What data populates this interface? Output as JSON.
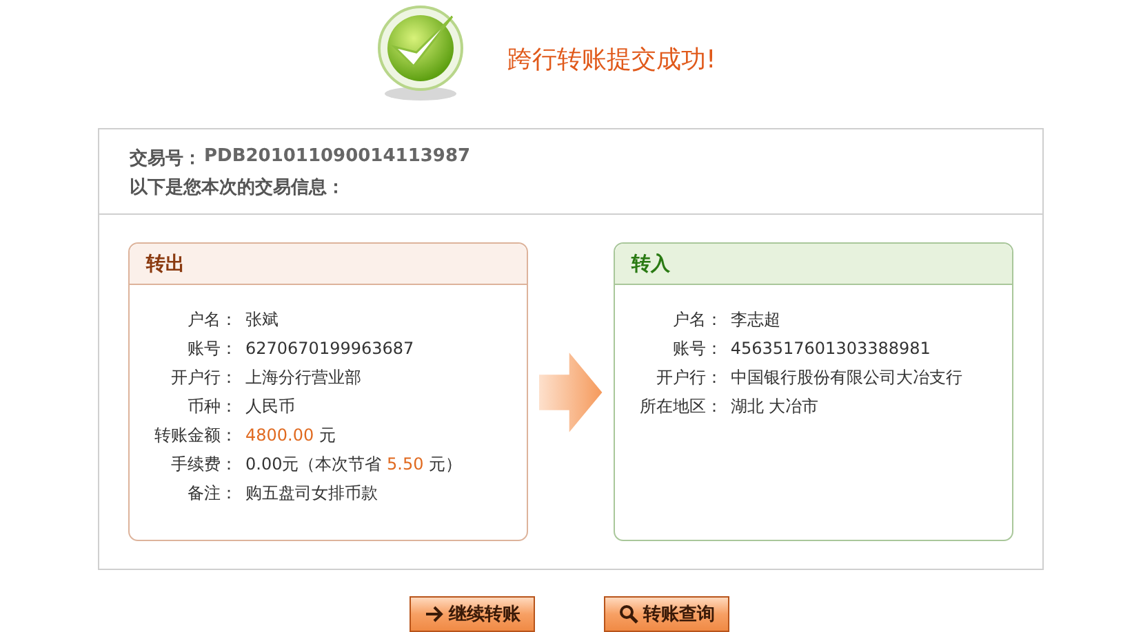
{
  "title": "跨行转账提交成功!",
  "transaction": {
    "label": "交易号：",
    "number": "PDB201011090014113987",
    "note": "以下是您本次的交易信息："
  },
  "panels": [
    {
      "kind": "out",
      "title": "转出",
      "rows": [
        {
          "label": "户名：",
          "segments": [
            {
              "text": "张斌",
              "highlight": false
            }
          ]
        },
        {
          "label": "账号：",
          "segments": [
            {
              "text": "6270670199963687",
              "highlight": false
            }
          ]
        },
        {
          "label": "开户行：",
          "segments": [
            {
              "text": "上海分行营业部",
              "highlight": false
            }
          ]
        },
        {
          "label": "币种：",
          "segments": [
            {
              "text": "人民币",
              "highlight": false
            }
          ]
        },
        {
          "label": "转账金额：",
          "segments": [
            {
              "text": "4800.00",
              "highlight": true
            },
            {
              "text": "元",
              "highlight": false
            }
          ]
        },
        {
          "label": "手续费：",
          "segments": [
            {
              "text": "0.00元（本次节省",
              "highlight": false
            },
            {
              "text": "5.50",
              "highlight": true
            },
            {
              "text": "元）",
              "highlight": false
            }
          ]
        },
        {
          "label": "备注：",
          "segments": [
            {
              "text": "购五盘司女排币款",
              "highlight": false
            }
          ]
        }
      ]
    },
    {
      "kind": "in",
      "title": "转入",
      "rows": [
        {
          "label": "户名：",
          "segments": [
            {
              "text": "李志超",
              "highlight": false
            }
          ]
        },
        {
          "label": "账号：",
          "segments": [
            {
              "text": "4563517601303388981",
              "highlight": false
            }
          ]
        },
        {
          "label": "开户行：",
          "segments": [
            {
              "text": "中国银行股份有限公司大冶支行",
              "highlight": false
            }
          ]
        },
        {
          "label": "所在地区：",
          "segments": [
            {
              "text": "湖北 大冶市",
              "highlight": false
            }
          ]
        }
      ]
    }
  ],
  "buttons": [
    {
      "kind": "continue",
      "label": "继续转账"
    },
    {
      "kind": "query",
      "label": "转账查询"
    }
  ]
}
